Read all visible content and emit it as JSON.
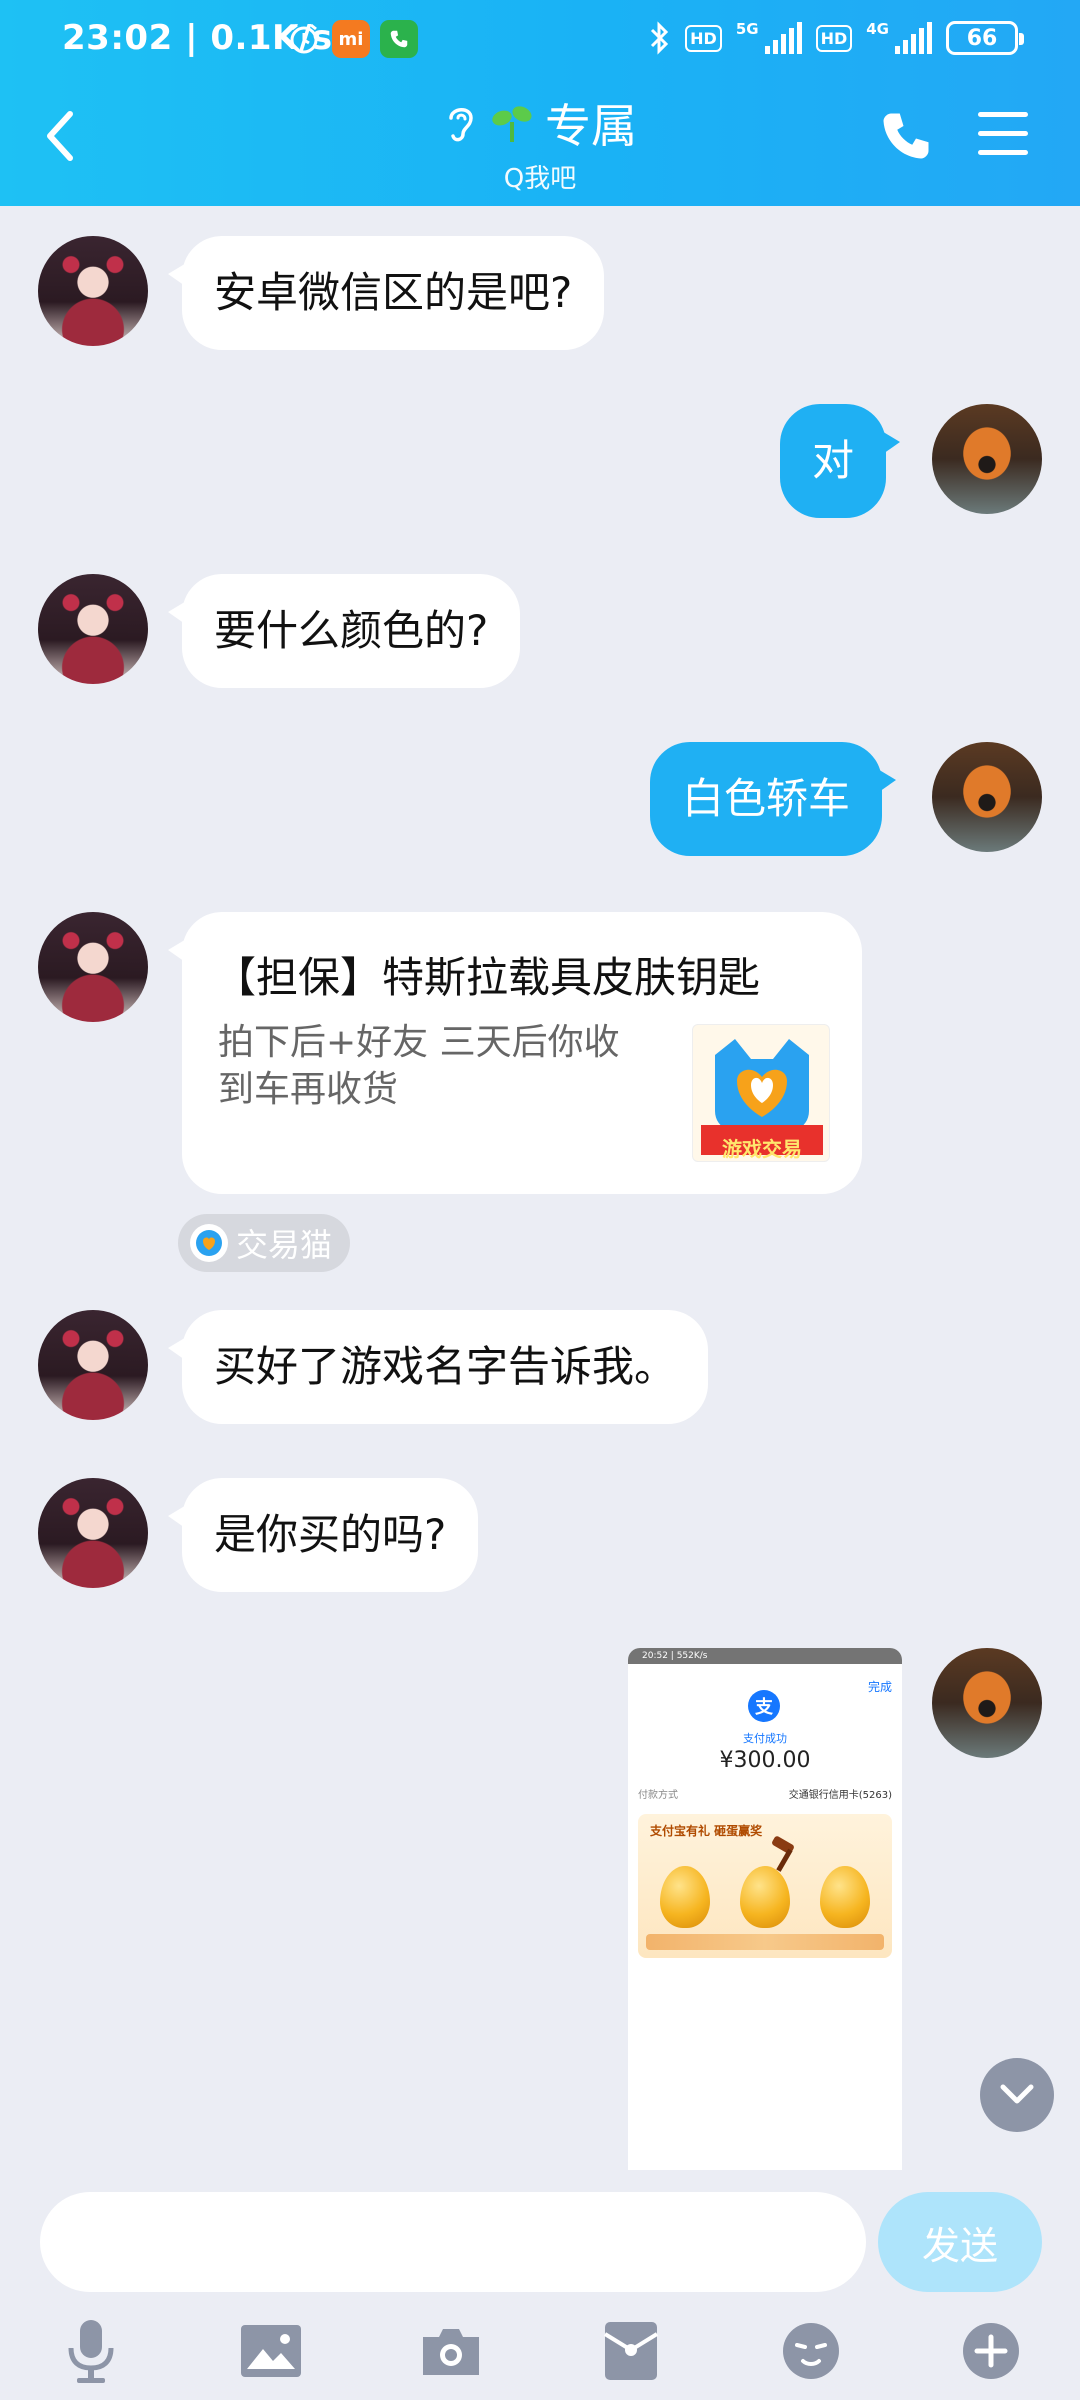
{
  "status_bar": {
    "time_speed": "23:02 | 0.1K/s",
    "net_5g": "5G",
    "net_4g": "4G",
    "hd1": "HD",
    "hd2": "HD",
    "battery": "66"
  },
  "header": {
    "title": "专属",
    "subtitle": "Q我吧"
  },
  "messages": [
    {
      "side": "in",
      "text": "安卓微信区的是吧?"
    },
    {
      "side": "out",
      "text": "对"
    },
    {
      "side": "in",
      "text": "要什么颜色的?"
    },
    {
      "side": "out",
      "text": "白色轿车"
    },
    {
      "side": "in",
      "text": "买好了游戏名字告诉我。"
    },
    {
      "side": "in",
      "text": "是你买的吗?"
    }
  ],
  "card": {
    "title": "【担保】特斯拉载具皮肤钥匙",
    "description": "拍下后+好友 三天后你收到车再收货",
    "logo_text": "游戏交易",
    "source": "交易猫"
  },
  "screenshot": {
    "status": "20:52 | 552K/s",
    "done": "完成",
    "success": "支付成功",
    "amount": "¥300.00",
    "pay_method_label": "付款方式",
    "card": "交通银行信用卡(5263)",
    "banner_title": "支付宝有礼 砸蛋赢奖"
  },
  "input": {
    "placeholder": "",
    "send_label": "发送"
  },
  "colors": {
    "header_blue": "#1ab2f5",
    "out_bubble": "#1fb0f3",
    "chat_bg": "#ebedf4",
    "send_disabled": "#aee4fb"
  },
  "icons": [
    "back-icon",
    "ear-icon",
    "sprout-icon",
    "phone-icon",
    "menu-icon",
    "microphone-icon",
    "image-icon",
    "camera-icon",
    "red-packet-icon",
    "emoji-icon",
    "plus-icon",
    "chevron-down-icon"
  ]
}
